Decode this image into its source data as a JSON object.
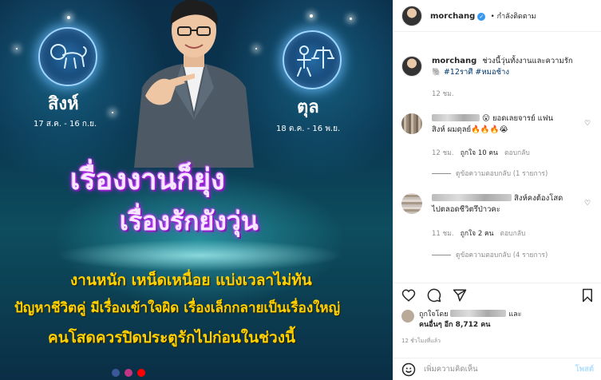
{
  "poster": {
    "left_sign": {
      "name": "สิงห์",
      "dates": "17 ส.ค. - 16 ก.ย."
    },
    "right_sign": {
      "name": "ตุล",
      "dates": "18 ต.ค. - 16 พ.ย."
    },
    "headline_1": "เรื่องงานก็ยุ่ง",
    "headline_2": "เรื่องรักยังวุ่น",
    "line_1": "งานหนัก เหน็ดเหนื่อย แบ่งเวลาไม่ทัน",
    "line_2": "ปัญหาชีวิตคู่ มีเรื่องเข้าใจผิด เรื่องเล็กกลายเป็นเรื่องใหญ่",
    "line_3": "คนโสดควรปิดประตูรักไปก่อนในช่วงนี้",
    "colors": {
      "headline": "#e070ff",
      "body_text": "#ffd200",
      "background": "#0b3350"
    }
  },
  "header": {
    "username": "morchang",
    "follow_status": "• กำลังติดตาม",
    "more_icon": "ellipsis-icon"
  },
  "caption": {
    "username": "morchang",
    "text": "ช่วงนี้วุ่นทั้งงานและความรัก",
    "text_2": "🐘 #12ราศี #หมอช้าง",
    "time": "12 ชม."
  },
  "comments": [
    {
      "text": "😮 ยอดเลยจารย์ แฟน",
      "text_2": "สิงห์ ผมดุลย์🔥🔥🔥😭",
      "time": "12 ชม.",
      "likes": "ถูกใจ 10 คน",
      "reply": "ตอบกลับ",
      "view_replies": "ดูข้อความตอบกลับ (1 รายการ)"
    },
    {
      "text": "สิงห์คงต้องโสด",
      "text_2": "ไปตลอดชีวิตรึป่าวคะ",
      "time": "11 ชม.",
      "likes": "ถูกใจ 2 คน",
      "reply": "ตอบกลับ",
      "view_replies": "ดูข้อความตอบกลับ (4 รายการ)"
    }
  ],
  "likes": {
    "liked_by": "ถูกใจโดย",
    "and": "และ",
    "others": "คนอื่นๆ อีก 8,712 คน"
  },
  "post_time": "12 ชั่วโมงที่แล้ว",
  "add_comment": {
    "placeholder": "เพิ่มความคิดเห็น",
    "post_label": "โพสต์"
  }
}
